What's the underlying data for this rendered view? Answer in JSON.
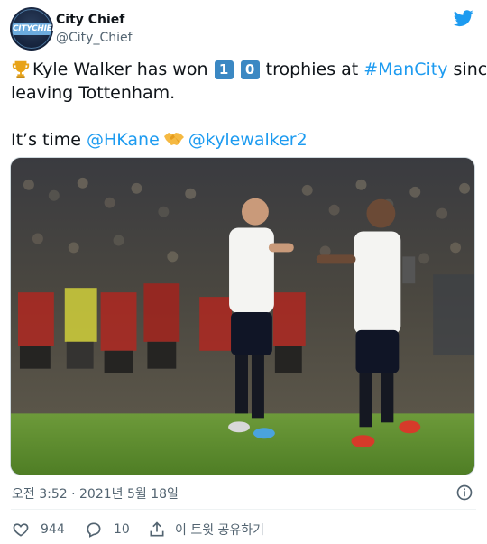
{
  "account": {
    "display_name": "City Chief",
    "handle": "@City_Chief",
    "avatar_text": "CITYCHIEF"
  },
  "tweet": {
    "text_part1": "Kyle Walker has won ",
    "keycap_1": "1",
    "keycap_2": "0",
    "text_part2": " trophies at ",
    "hashtag": "#ManCity",
    "text_part3": " since",
    "line2": "leaving Tottenham.",
    "line3_prefix": "It’s time ",
    "mention1": "@HKane",
    "mention2": "@kylewalker2"
  },
  "timestamp": "오전 3:52 · 2021년 5월 18일",
  "actions": {
    "like_count": "944",
    "reply_count": "10",
    "share_label": "이 트윗 공유하기"
  },
  "colors": {
    "link": "#1d9bf0",
    "twitter_blue": "#1d9bf0",
    "secondary_text": "#536471",
    "keycap": "#3b88c3"
  },
  "icons": [
    "twitter-logo-icon",
    "trophy-icon",
    "keycap-1",
    "keycap-0",
    "handshake-icon",
    "info-icon",
    "heart-icon",
    "reply-icon",
    "share-icon"
  ]
}
